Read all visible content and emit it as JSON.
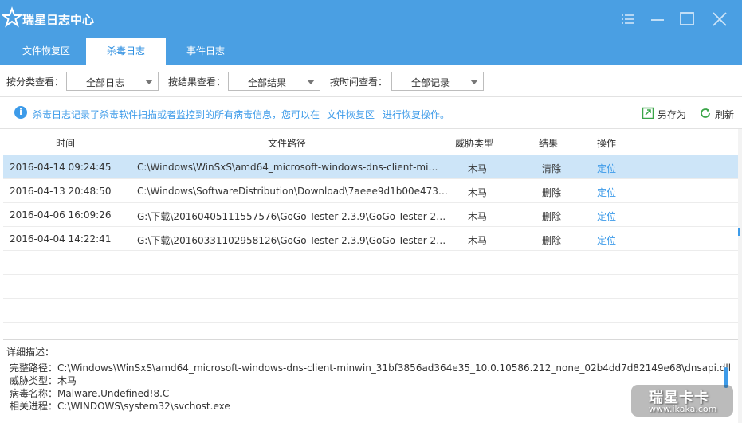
{
  "window": {
    "title": "瑞星日志中心"
  },
  "tabs": [
    {
      "label": "文件恢复区",
      "active": false
    },
    {
      "label": "杀毒日志",
      "active": true
    },
    {
      "label": "事件日志",
      "active": false
    }
  ],
  "filters": {
    "category_label": "按分类查看：",
    "category_value": "全部日志",
    "result_label": "按结果查看：",
    "result_value": "全部结果",
    "time_label": "按时间查看：",
    "time_value": "全部记录"
  },
  "info": {
    "text_before": "杀毒日志记录了杀毒软件扫描或者监控到的所有病毒信息，您可以在",
    "link": "文件恢复区",
    "text_after": "进行恢复操作。",
    "save_as": "另存为",
    "refresh": "刷新"
  },
  "table": {
    "headers": {
      "time": "时间",
      "path": "文件路径",
      "threat": "威胁类型",
      "result": "结果",
      "action": "操作"
    },
    "rows": [
      {
        "time": "2016-04-14 09:24:45",
        "path": "C:\\Windows\\WinSxS\\amd64_microsoft-windows-dns-client-min...",
        "threat": "木马",
        "result": "清除",
        "action": "定位",
        "selected": true
      },
      {
        "time": "2016-04-13 20:48:50",
        "path": "C:\\Windows\\SoftwareDistribution\\Download\\7aeee9d1b00e4732...",
        "threat": "木马",
        "result": "删除",
        "action": "定位",
        "selected": false
      },
      {
        "time": "2016-04-06 16:09:26",
        "path": "G:\\下载\\20160405111557576\\GoGo Tester 2.3.9\\GoGo Tester 2.3....",
        "threat": "木马",
        "result": "删除",
        "action": "定位",
        "selected": false
      },
      {
        "time": "2016-04-04 14:22:41",
        "path": "G:\\下载\\20160331102958126\\GoGo Tester 2.3.9\\GoGo Tester 2.3....",
        "threat": "木马",
        "result": "删除",
        "action": "定位",
        "selected": false
      }
    ]
  },
  "details": {
    "title": "详细描述：",
    "full_path_label": "完整路径：",
    "full_path": "C:\\Windows\\WinSxS\\amd64_microsoft-windows-dns-client-minwin_31bf3856ad364e35_10.0.10586.212_none_02b4dd7d82149e68\\dnsapi.dll",
    "threat_label": "威胁类型：",
    "threat": "木马",
    "virus_label": "病毒名称：",
    "virus": "Malware.Undefined!8.C",
    "process_label": "相关进程：",
    "process": "C:\\WINDOWS\\system32\\svchost.exe"
  },
  "watermark": {
    "line1": "瑞星卡卡",
    "line2": "www.ikaka.com"
  },
  "colors": {
    "accent": "#4a9fe3",
    "link": "#3d9be9",
    "selected_row": "#cde5f8"
  },
  "icons": [
    "star-logo-icon",
    "menu-icon",
    "minimize-icon",
    "maximize-icon",
    "close-icon",
    "info-icon",
    "save-as-icon",
    "refresh-icon",
    "chevron-down-icon"
  ]
}
